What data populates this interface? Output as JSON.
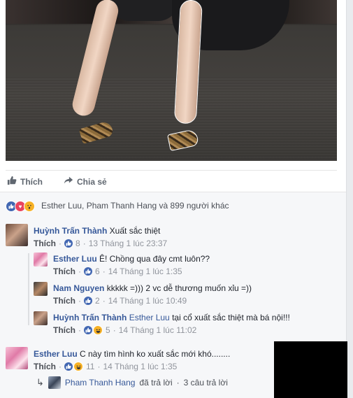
{
  "actions": {
    "like_label": "Thích",
    "share_label": "Chia sẻ"
  },
  "summary": {
    "text": "Esther Luu, Pham Thanh Hang và 899 người khác"
  },
  "comments": [
    {
      "name": "Huỳnh Trấn Thành",
      "text": " Xuất sắc thiệt",
      "like": "Thích",
      "count": "8",
      "time": "13 Tháng 1 lúc 23:37"
    },
    {
      "name": "Esther Luu",
      "text": " Ê! Chồng qua đây cmt luôn??",
      "like": "Thích",
      "count": "6",
      "time": "14 Tháng 1 lúc 1:35"
    },
    {
      "name": "Nam Nguyen",
      "text": " kkkkk =))) 2 vc dễ thương muốn xỉu =))",
      "like": "Thích",
      "count": "2",
      "time": "14 Tháng 1 lúc 10:49"
    },
    {
      "name": "Huỳnh Trấn Thành",
      "tag": "Esther Luu",
      "text": " tại cổ xuất sắc thiệt mà bá nội!!!",
      "like": "Thích",
      "count": "5",
      "time": "14 Tháng 1 lúc 11:02"
    },
    {
      "name": "Esther Luu",
      "text": " C này tìm hình ko xuất sắc mới khó........",
      "like": "Thích",
      "count": "11",
      "time": "14 Tháng 1 lúc 1:35"
    }
  ],
  "replies": {
    "name": "Pham Thanh Hang",
    "text": "đã trả lời",
    "count": "3 câu trả lời"
  },
  "separator": "·",
  "colors": {
    "link": "#365899",
    "like_blue": "#4267b2",
    "love_red": "#e9445f",
    "wow_yellow": "#f7b125"
  }
}
